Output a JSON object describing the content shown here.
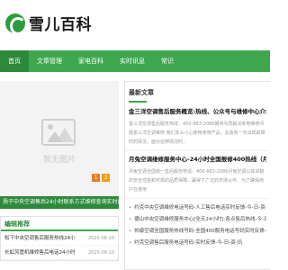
{
  "logo": {
    "text": "雪儿百科"
  },
  "nav": [
    {
      "label": "首页",
      "active": true
    },
    {
      "label": "文章管理",
      "active": false
    },
    {
      "label": "家电百科",
      "active": false
    },
    {
      "label": "实时讯息",
      "active": false
    },
    {
      "label": "常识",
      "active": false
    }
  ],
  "slider": {
    "placeholder": "暂无图片",
    "pages": [
      "1",
      "2"
    ],
    "caption": "扬子中央空调售后24小时联系方式维修查询实时反"
  },
  "recommend": {
    "title": "编辑推荐",
    "items": [
      {
        "title": "松下中央空调售后服务热线24小",
        "date": "2025-08-10"
      },
      {
        "title": "长虹风管机维修售后电话24小时",
        "date": "2025-08-10"
      }
    ]
  },
  "latest": {
    "title": "最新文章",
    "articles": [
      {
        "title": "金三洋空调售后服务概览:热线、公众号与维修中心介绍（金三洋",
        "desc": "金三洋空调售后服务热线：400-883-2086期待为您解决家电维修问题金三洋空调维修 我们多么小心使用家电产品，总会有一天出现故障时的情况，面对这种情况时，"
      },
      {
        "title": "月兔空调维修服务中心-24小时全国报修400热线（月兔空调售后",
        "desc": "月兔空调全国统一售后服务电话：400-883-2086月兔空调以其卓越的安全性能和可靠的品质保障，赢得了广泛的市场认可。为了确保用户在使用"
      }
    ],
    "links": [
      "约克中央空调维修电话号码-人工售后电话实时反馈-今-日-资-讯",
      "德山中央空调维修服务中心[全天24小时]-各点售后热线-今-日-资-讯",
      "帅康空调全国服务热线号码-全国400服务电话号码实时反馈-今-日-资-讯",
      "约克空调售后服务电话号码-实时反馈-今-日-资-讯"
    ]
  },
  "colors": {
    "brand": "#3fa84f",
    "brand_dark": "#2d8a3b",
    "pager": "#f39c12"
  }
}
